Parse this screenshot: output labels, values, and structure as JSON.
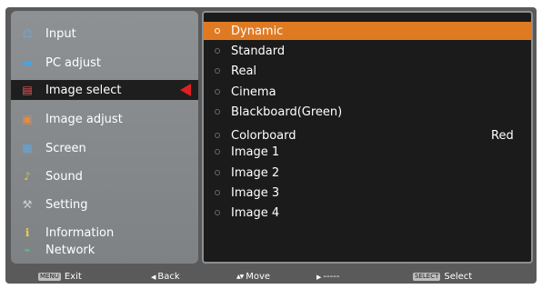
{
  "menu": {
    "items": [
      {
        "label": "Input",
        "icon": "input-icon",
        "glyph": "☖",
        "color": "#6ab0e8"
      },
      {
        "label": "PC adjust",
        "icon": "pc-adjust-icon",
        "glyph": "▬",
        "color": "#4aa3e0"
      },
      {
        "label": "Image select",
        "icon": "image-select-icon",
        "glyph": "▤",
        "color": "#e85a5a"
      },
      {
        "label": "Image adjust",
        "icon": "image-adjust-icon",
        "glyph": "▣",
        "color": "#f08a30"
      },
      {
        "label": "Screen",
        "icon": "screen-icon",
        "glyph": "▦",
        "color": "#5aa8e8"
      },
      {
        "label": "Sound",
        "icon": "sound-icon",
        "glyph": "♪",
        "color": "#e0c050"
      },
      {
        "label": "Setting",
        "icon": "setting-icon",
        "glyph": "⚒",
        "color": "#d0d0d0"
      },
      {
        "label": "Information",
        "icon": "information-icon",
        "glyph": "ℹ",
        "color": "#f0d040"
      },
      {
        "label": "Network",
        "icon": "network-icon",
        "glyph": "⌁",
        "color": "#50d080"
      }
    ],
    "selected_index": 2
  },
  "options": {
    "items": [
      {
        "label": "Dynamic",
        "value": ""
      },
      {
        "label": "Standard",
        "value": ""
      },
      {
        "label": "Real",
        "value": ""
      },
      {
        "label": "Cinema",
        "value": ""
      },
      {
        "label": "Blackboard(Green)",
        "value": ""
      },
      {
        "label": "Colorboard",
        "value": "Red"
      },
      {
        "label": "Image 1",
        "value": ""
      },
      {
        "label": "Image 2",
        "value": ""
      },
      {
        "label": "Image 3",
        "value": ""
      },
      {
        "label": "Image 4",
        "value": ""
      }
    ],
    "selected_index": 0
  },
  "statusbar": {
    "exit_key": "MENU",
    "exit_label": "Exit",
    "back_glyph": "◀",
    "back_label": "Back",
    "move_glyph": "▲▼",
    "move_label": "Move",
    "next_glyph": "▶",
    "next_label": "-----",
    "select_key": "SELECT",
    "select_label": "Select"
  },
  "colors": {
    "accent": "#e07a22",
    "arrow": "#e02020"
  }
}
